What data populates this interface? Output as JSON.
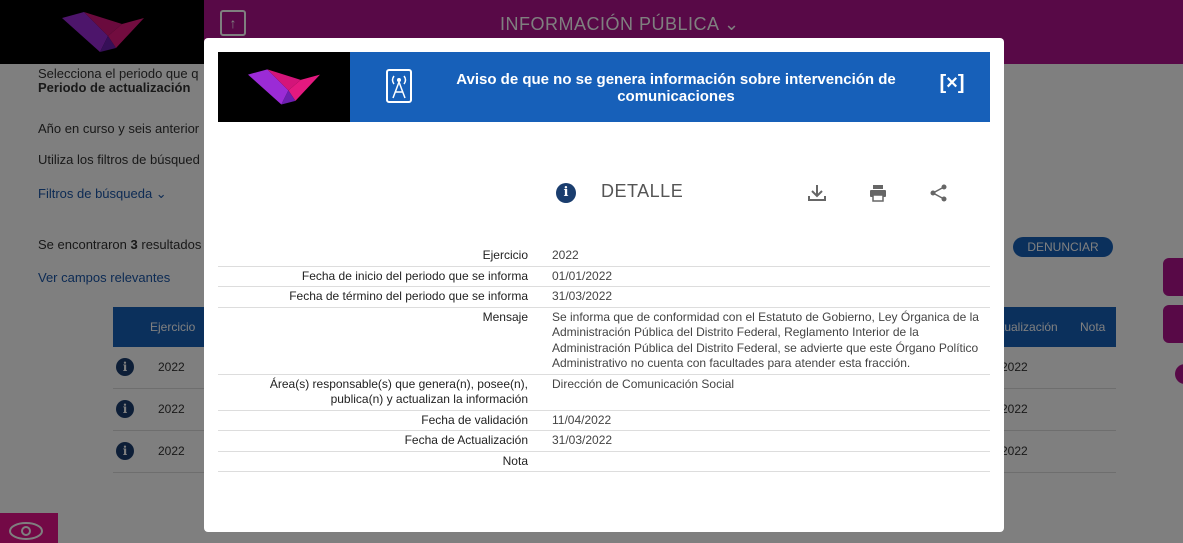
{
  "header": {
    "nav_title": "INFORMACIÓN PÚBLICA ⌄"
  },
  "page": {
    "intro_text": "Selecciona el periodo que q",
    "period_label": "Periodo de actualización",
    "year_text": "Año en curso y seis anterior",
    "filters_hint": "Utiliza los filtros de búsqued",
    "filters_link": "Filtros de búsqueda ⌄",
    "results_prefix": "Se encontraron ",
    "results_count": "3",
    "results_suffix": " resultados",
    "relevant_fields_link": "Ver campos relevantes",
    "denunciar_label": "DENUNCIAR",
    "table": {
      "col_ejercicio": "Ejercicio",
      "col_actualizacion": "tualización",
      "col_nota": "Nota",
      "rows": [
        {
          "info": "i",
          "ejercicio": "2022",
          "actualizacion": "2022"
        },
        {
          "info": "i",
          "ejercicio": "2022",
          "actualizacion": "2022"
        },
        {
          "info": "i",
          "ejercicio": "2022",
          "actualizacion": "2022"
        }
      ]
    }
  },
  "modal": {
    "title_line1": "Aviso de que no se genera información sobre intervención de",
    "title_line2": "comunicaciones",
    "close_label": "[×]",
    "detail_label": "DETALLE",
    "info_glyph": "i",
    "fields": [
      {
        "label": "Ejercicio",
        "value": "2022"
      },
      {
        "label": "Fecha de inicio del periodo que se informa",
        "value": "01/01/2022"
      },
      {
        "label": "Fecha de término del periodo que se informa",
        "value": "31/03/2022"
      },
      {
        "label": "Mensaje",
        "value": "Se informa que de conformidad con el Estatuto de Gobierno, Ley Órganica de la Administración Pública del Distrito Federal, Reglamento Interior de la Administración Pública del Distrito Federal, se advierte que este Órgano Político Administrativo no cuenta con facultades para atender esta fracción."
      },
      {
        "label": "Área(s) responsable(s) que genera(n), posee(n), publica(n) y actualizan la información",
        "value": "Dirección de Comunicación Social"
      },
      {
        "label": "Fecha de validación",
        "value": "11/04/2022"
      },
      {
        "label": "Fecha de Actualización",
        "value": "31/03/2022"
      },
      {
        "label": "Nota",
        "value": ""
      }
    ]
  },
  "colors": {
    "brand_magenta": "#b0128f",
    "primary_blue": "#1760b9",
    "info_navy": "#1a3d6e"
  },
  "icons": [
    "logo-icon",
    "antenna-tower-icon",
    "close-icon",
    "info-icon",
    "download-icon",
    "print-icon",
    "share-icon",
    "accessibility-icon"
  ]
}
